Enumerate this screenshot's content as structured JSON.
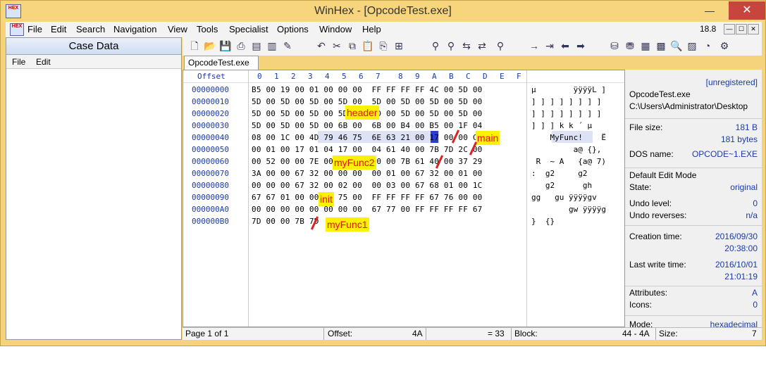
{
  "window": {
    "title": "WinHex - [OpcodeTest.exe]",
    "logo": "HEX",
    "minimize": "—",
    "maximize": "☐",
    "close": "✕"
  },
  "menu": {
    "items": [
      "File",
      "Edit",
      "Search",
      "Navigation",
      "View",
      "Tools",
      "Specialist",
      "Options",
      "Window",
      "Help"
    ],
    "version": "18.8"
  },
  "case_panel": {
    "title": "Case Data",
    "menu": [
      "File",
      "Edit"
    ]
  },
  "toolbar": {
    "icons": [
      "new-file-icon",
      "open-icon",
      "save-icon",
      "print-icon",
      "properties-icon",
      "undo-icon",
      "copy-icon",
      "paste-icon",
      "find-icon",
      "replace-icon",
      "goto-icon",
      "forward-icon",
      "back-icon",
      "disk-icon",
      "ram-icon",
      "calculator-icon",
      "search-icon"
    ]
  },
  "tab": {
    "label": "OpcodeTest.exe"
  },
  "hex": {
    "offset_header": "Offset",
    "columns": [
      "0",
      "1",
      "2",
      "3",
      "4",
      "5",
      "6",
      "7",
      "8",
      "9",
      "A",
      "B",
      "C",
      "D",
      "E",
      "F"
    ],
    "rows": [
      {
        "offset": "00000000",
        "bytes": "B5 00 19 00 01 00 00 00  FF FF FF FF 4C 00 5D 00",
        "ascii": "µ        ÿÿÿÿL ]"
      },
      {
        "offset": "00000010",
        "bytes": "5D 00 5D 00 5D 00 5D 00  5D 00 5D 00 5D 00 5D 00",
        "ascii": "] ] ] ] ] ] ] ] "
      },
      {
        "offset": "00000020",
        "bytes": "5D 00 5D 00 5D 00 5D 00  5D 00 5D 00 5D 00 5D 00",
        "ascii": "] ] ] ] ] ] ] ] "
      },
      {
        "offset": "00000030",
        "bytes": "5D 00 5D 00 5D 00 6B 00  6B 00 B4 00 B5 00 1F 04",
        "ascii": "] ] ] k k ´ µ   "
      },
      {
        "offset": "00000040",
        "bytes": "08 00 1C 00 4D 79 46 75  6E 63 21 00 17 00 00 CB",
        "ascii": "    MyFunc!    Ë"
      },
      {
        "offset": "00000050",
        "bytes": "00 01 00 17 01 04 17 00  04 61 40 00 7B 7D 2C 00",
        "ascii": "         a@ {},"
      },
      {
        "offset": "00000060",
        "bytes": "00 52 00 00 7E 00 00 00  00 00 7B 61 40 00 37 29",
        "ascii": " R  ~ A   {a@ 7)"
      },
      {
        "offset": "00000070",
        "bytes": "3A 00 00 67 32 00 00 00  00 01 00 67 32 00 01 00",
        "ascii": ":  g2     g2   "
      },
      {
        "offset": "00000080",
        "bytes": "00 00 00 67 32 00 02 00  00 03 00 67 68 01 00 1C",
        "ascii": "   g2      gh   "
      },
      {
        "offset": "00000090",
        "bytes": "67 67 01 00 00 67 75 00  FF FF FF FF 67 76 00 00",
        "ascii": "gg   gu ÿÿÿÿgv  "
      },
      {
        "offset": "000000A0",
        "bytes": "00 00 00 00 00 00 00 00  67 77 00 FF FF FF FF 67",
        "ascii": "        gw ÿÿÿÿg"
      },
      {
        "offset": "000000B0",
        "bytes": "7D 00 00 7B 7D",
        "ascii": "}  {}"
      }
    ]
  },
  "annotations": [
    "header",
    "main",
    "myFunc2",
    "init",
    "myFunc1"
  ],
  "status": {
    "page": "Page 1 of 1",
    "offset_label": "Offset:",
    "offset_value": "4A",
    "eq_value": "= 33",
    "block_label": "Block:",
    "block_value": "44 - 4A",
    "size_label": "Size:",
    "size_value": "7"
  },
  "info": {
    "unregistered": "[unregistered]",
    "filename": "OpcodeTest.exe",
    "path": "C:\\Users\\Administrator\\Desktop",
    "file_size_label": "File size:",
    "file_size_value": "181 B",
    "file_size_bytes": "181 bytes",
    "dos_name_label": "DOS name:",
    "dos_name_value": "OPCODE~1.EXE",
    "edit_mode": "Default Edit Mode",
    "state_label": "State:",
    "state_value": "original",
    "undo_level_label": "Undo level:",
    "undo_level_value": "0",
    "undo_rev_label": "Undo reverses:",
    "undo_rev_value": "n/a",
    "creation_label": "Creation time:",
    "creation_date": "2016/09/30",
    "creation_time": "20:38:00",
    "write_label": "Last write time:",
    "write_date": "2016/10/01",
    "write_time": "21:01:19",
    "attr_label": "Attributes:",
    "attr_value": "A",
    "icons_label": "Icons:",
    "icons_value": "0",
    "mode_label": "Mode:",
    "mode_value": "hexadecimal"
  },
  "colors": {
    "frame": "#f5d37a",
    "offset_text": "#1a3aaa",
    "annotation_bg": "#fff200",
    "annotation_text": "#e01010",
    "close_button": "#c7453c"
  }
}
